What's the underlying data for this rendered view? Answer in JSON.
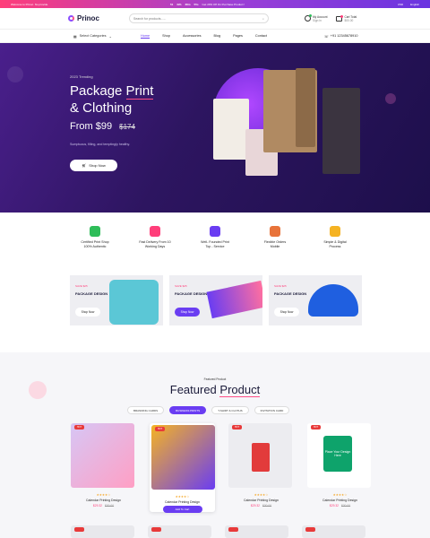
{
  "topbar": {
    "welcome": "Welcome to Prinoc. No.provide",
    "timer": [
      "51",
      "22h",
      "38m",
      "55s"
    ],
    "offer": "Get 20% Off On Purchase Product !",
    "lang": "USD",
    "currency": "English"
  },
  "header": {
    "logo": "Prinoc",
    "search_placeholder": "Search for products......",
    "account_label": "My Account",
    "account_sub": "Sign In",
    "cart_label": "Cart Total",
    "cart_sub": "$00.00"
  },
  "nav": {
    "categories": "Select Categories",
    "items": [
      "Home",
      "Shop",
      "Accessories",
      "Blog",
      "Pages",
      "Contact"
    ],
    "phone": "+91 12345678910"
  },
  "hero": {
    "tag": "2023 Trending",
    "title_1": "Package",
    "title_hl": "Print",
    "title_2": "& Clothing",
    "price_prefix": "From",
    "price": "$99",
    "old_price": "$174",
    "desc": "Sumptuous, filling, and temptingly healthy.",
    "button": "Shop Now"
  },
  "features": [
    {
      "l1": "Certified Print Shop",
      "l2": "100% Authentic",
      "color": "#2ebd59"
    },
    {
      "l1": "Fast Delivery From 10",
      "l2": "Working Days",
      "color": "#ff3e7a"
    },
    {
      "l1": "Well- Founded Print",
      "l2": "Top - Service",
      "color": "#6a3df2"
    },
    {
      "l1": "Flexible Orders",
      "l2": "Mobile",
      "color": "#e8733a"
    },
    {
      "l1": "Simple & Digital",
      "l2": "Process",
      "color": "#f5b323"
    }
  ],
  "promos": [
    {
      "off": "SAVE $25",
      "title": "PACKAGE DESIGN",
      "button": "Shop Now"
    },
    {
      "off": "SAVE $25",
      "title": "PACKAGE DESIGN",
      "button": "Shop Now"
    },
    {
      "off": "SAVE $25",
      "title": "PACKAGE DESIGN",
      "button": "Shop Now"
    }
  ],
  "featured": {
    "small": "Featured Product",
    "title_1": "Featured",
    "title_hl": "Product",
    "tabs": [
      "BRANDING CARDS",
      "BUSINESS PRINTS",
      "T-SHIRT & CLOTHS",
      "INVITATION CARD"
    ],
    "products": [
      {
        "badge": "HOT",
        "stars": "★★★★☆",
        "name": "Calendar Printing Design",
        "price": "$29.32",
        "old": "$30.00"
      },
      {
        "badge": "HOT",
        "stars": "★★★★☆",
        "name": "Calendar Printing Design",
        "price": "",
        "old": "",
        "add": "Add To Cart"
      },
      {
        "badge": "HOT",
        "stars": "★★★★☆",
        "name": "Calendar Printing Design",
        "price": "$29.32",
        "old": "$30.00"
      },
      {
        "badge": "HOT",
        "stars": "★★★★☆",
        "name": "Calendar Printing Design",
        "price": "$29.32",
        "old": "$30.00"
      }
    ],
    "mug_text": "Place Your Design Here"
  },
  "colors": {
    "accent": "#6a3df2",
    "pink": "#ff3e7a",
    "hero_bg": "#2d1560"
  }
}
